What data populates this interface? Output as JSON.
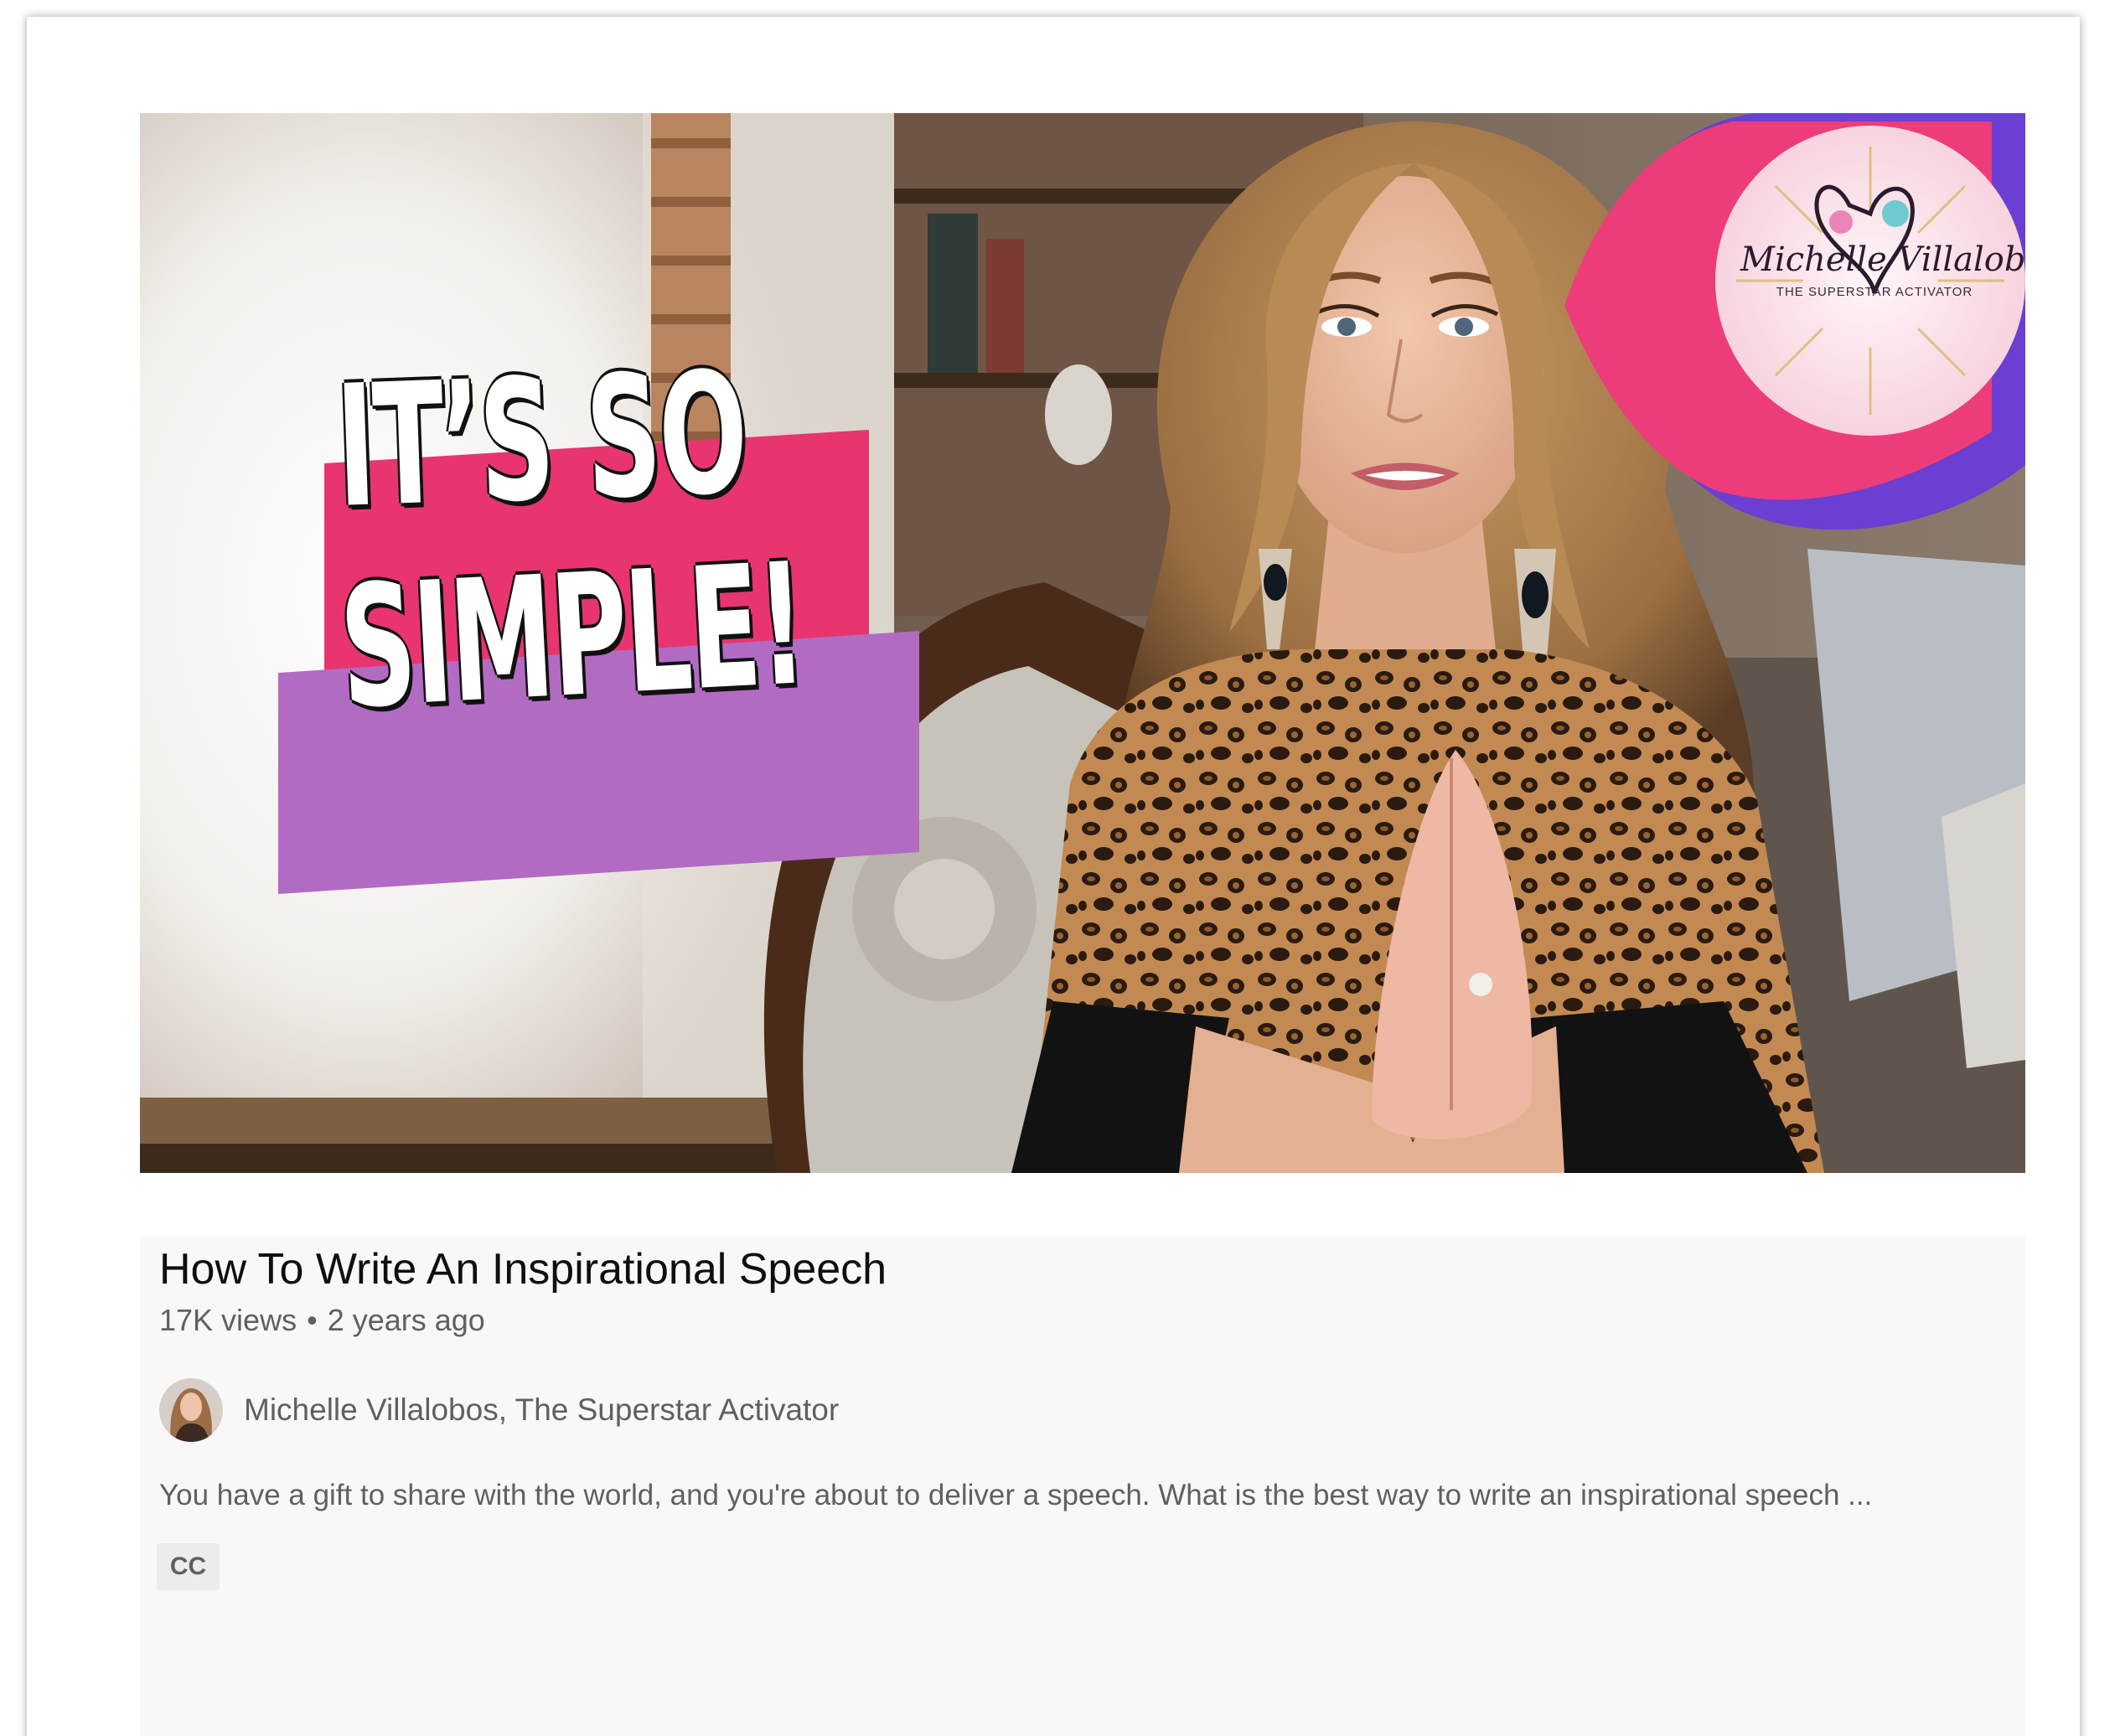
{
  "video": {
    "thumbnail": {
      "caption_line_1": "IT’S SO",
      "caption_line_2": "SIMPLE!",
      "logo_name": "Michelle Villalobos",
      "logo_tagline": "THE SUPERSTAR ACTIVATOR"
    },
    "title": "How To Write An Inspirational Speech",
    "views": "17K views",
    "separator": "•",
    "age": "2 years ago",
    "channel_name": "Michelle Villalobos, The Superstar Activator",
    "description": "You have a gift to share with the world, and you're about to deliver a speech. What is the best way to write an inspirational speech ...",
    "badge": "CC"
  },
  "colors": {
    "caption_pink": "#e8356f",
    "caption_purple": "#b26bc2",
    "details_background": "#f8f8f8",
    "title_text": "#0f0f0f",
    "secondary_text": "#606060"
  }
}
